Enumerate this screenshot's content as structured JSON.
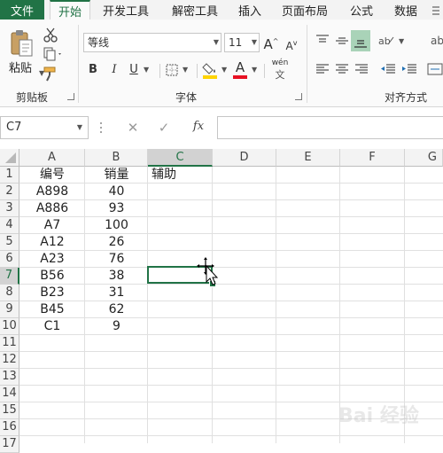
{
  "tabs": [
    {
      "label": "文件"
    },
    {
      "label": "开始"
    },
    {
      "label": "开发工具"
    },
    {
      "label": "解密工具"
    },
    {
      "label": "插入"
    },
    {
      "label": "页面布局"
    },
    {
      "label": "公式"
    },
    {
      "label": "数据"
    }
  ],
  "ribbon": {
    "clipboard": {
      "paste_label": "粘贴",
      "group_label": "剪贴板"
    },
    "font": {
      "name": "等线",
      "size": "11",
      "bold": "B",
      "italic": "I",
      "underline": "U",
      "grow": "A",
      "shrink": "A",
      "color_letter": "A",
      "phonetic": "wén",
      "group_label": "字体",
      "font_color": "#e81123",
      "fill_color": "#ffd400"
    },
    "alignment": {
      "group_label": "对齐方式"
    }
  },
  "formula_bar": {
    "name_box": "C7",
    "cancel": "✕",
    "enter": "✓",
    "fx": "fx",
    "value": ""
  },
  "grid": {
    "columns": [
      "A",
      "B",
      "C",
      "D",
      "E",
      "F",
      "G"
    ],
    "selected_column": "C",
    "rows": [
      "1",
      "2",
      "3",
      "4",
      "5",
      "6",
      "7",
      "8",
      "9",
      "10",
      "11",
      "12",
      "13",
      "14",
      "15",
      "16",
      "17"
    ],
    "selected_row": "7",
    "cells": {
      "A": [
        "编号",
        "A898",
        "A886",
        "A7",
        "A12",
        "A23",
        "B56",
        "B23",
        "B45",
        "C1"
      ],
      "B": [
        "销量",
        "40",
        "93",
        "100",
        "26",
        "76",
        "38",
        "31",
        "62",
        "9"
      ],
      "C": [
        "辅助"
      ]
    }
  },
  "watermark": {
    "text": "Bai 经验"
  }
}
